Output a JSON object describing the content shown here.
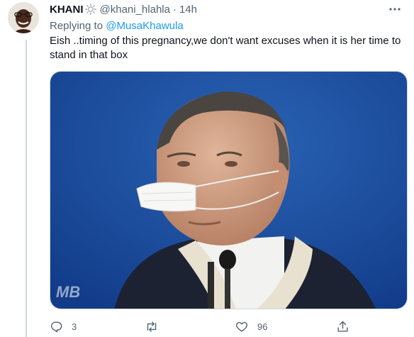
{
  "tweet": {
    "display_name": "KHANI",
    "name_emoji": "sun-outline-emoji",
    "handle": "@khani_hlahla",
    "separator": "·",
    "time": "14h",
    "replying_prefix": "Replying to ",
    "replying_to": "@MusaKhawula",
    "text": "Eish ..timing of this pregnancy,we don't want excuses when it is her time to stand in that box",
    "media": {
      "watermark": "MB",
      "description_icon": "man-wearing-mask-on-nose-photo"
    },
    "actions": {
      "reply_count": "3",
      "retweet_count": "",
      "like_count": "96",
      "share_count": ""
    }
  },
  "icons": {
    "more": "more-horizontal-icon",
    "reply": "reply-icon",
    "retweet": "retweet-icon",
    "like": "heart-icon",
    "share": "share-icon"
  },
  "colors": {
    "accent": "#1d9bf0",
    "secondary_text": "#536471",
    "primary_text": "#0f1419",
    "thread_line": "#cfd9de"
  }
}
